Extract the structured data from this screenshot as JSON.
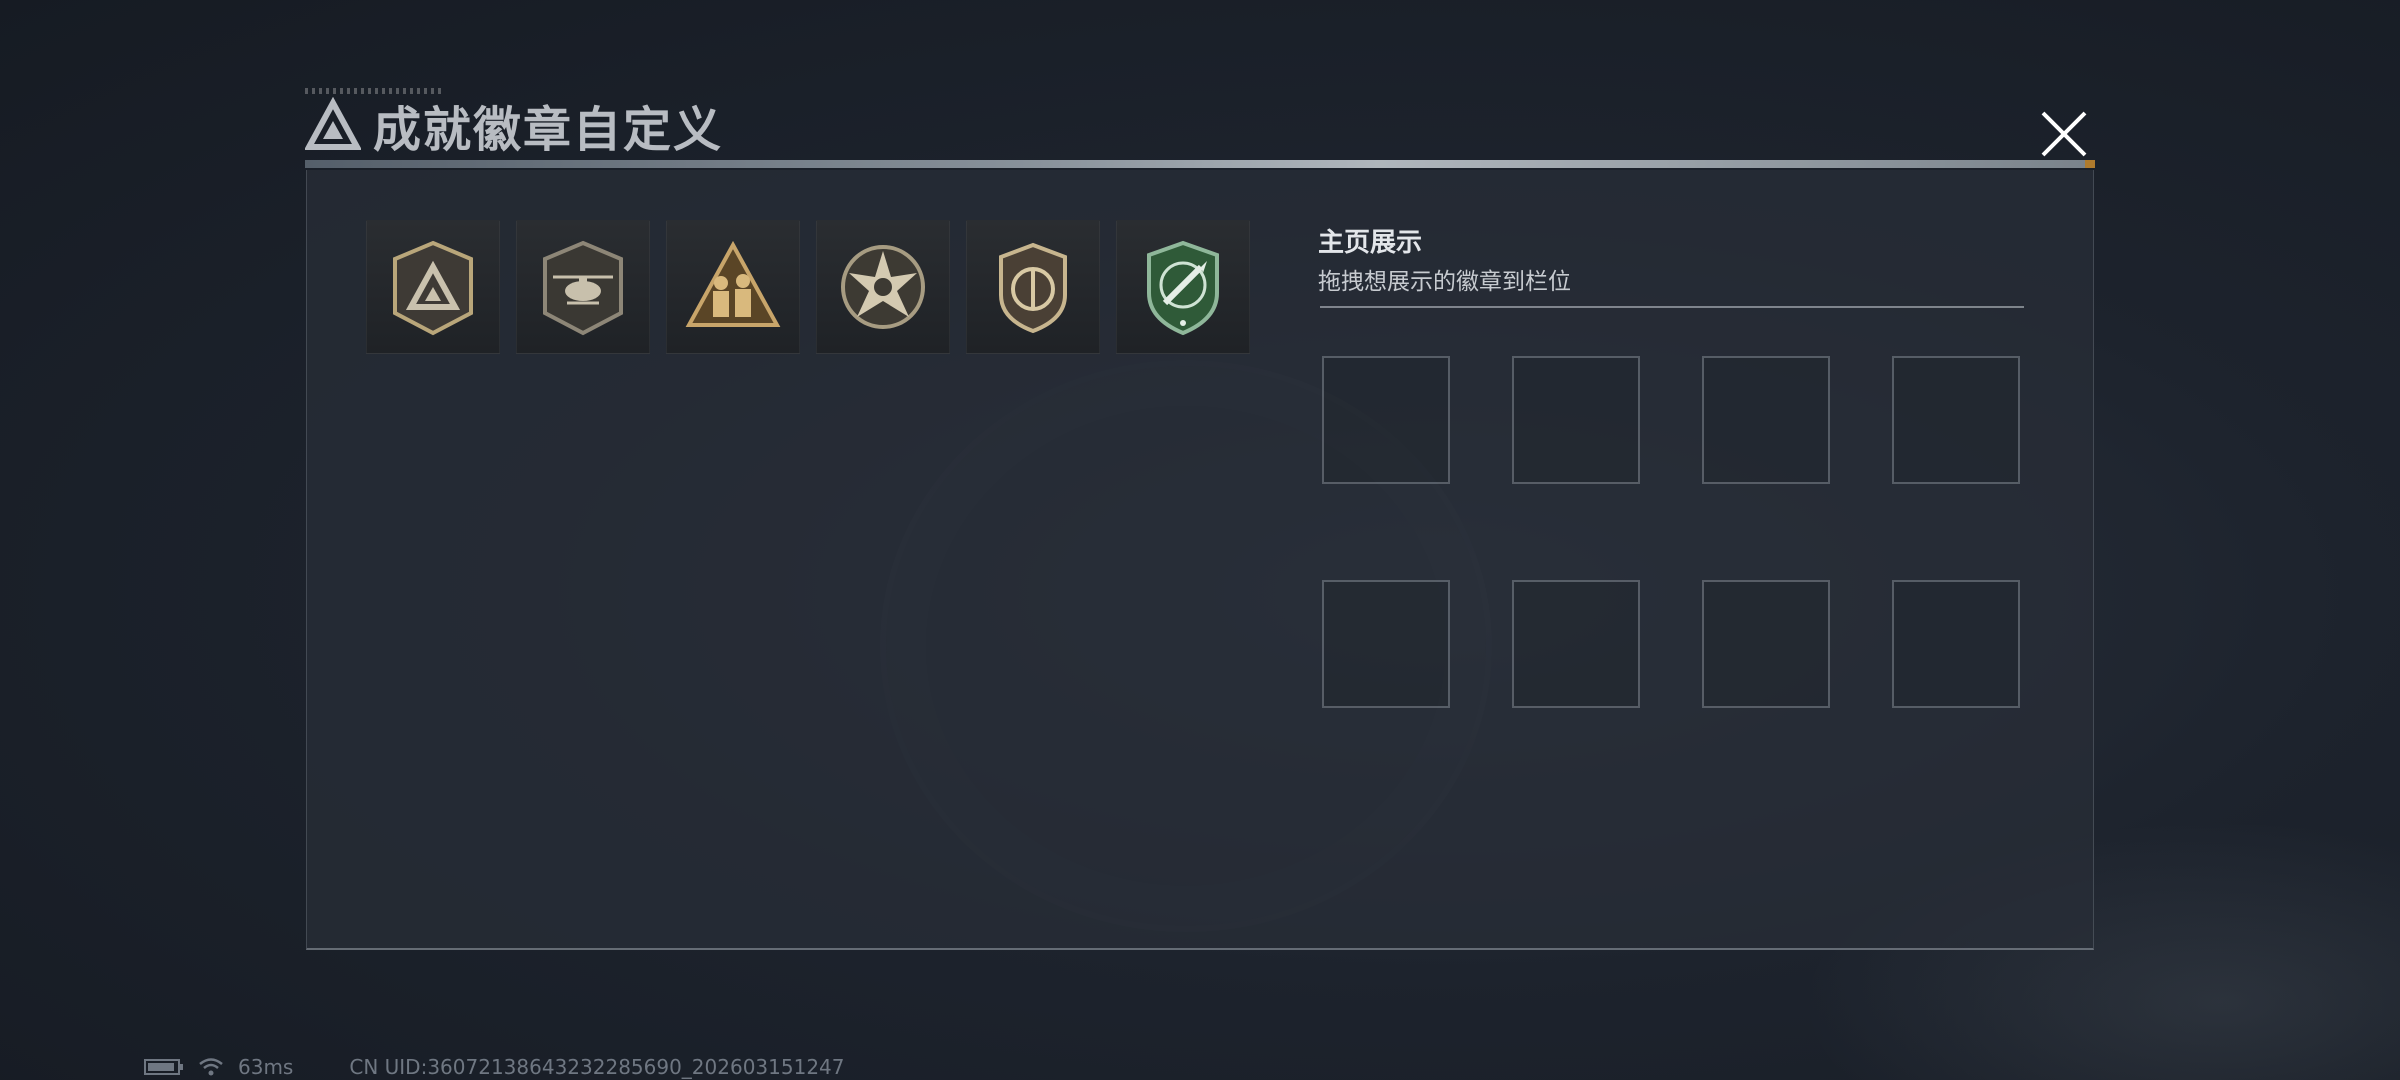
{
  "dialog": {
    "title": "成就徽章自定义",
    "title_icon": "triangle-logo-icon",
    "close_icon": "close-icon"
  },
  "badges": [
    {
      "icon": "shield-triangle-badge-icon"
    },
    {
      "icon": "helicopter-badge-icon"
    },
    {
      "icon": "soldiers-triangle-badge-icon"
    },
    {
      "icon": "star-skull-badge-icon"
    },
    {
      "icon": "shield-emblem-badge-icon"
    },
    {
      "icon": "green-knife-shield-badge-icon"
    }
  ],
  "showcase": {
    "title": "主页展示",
    "subtitle": "拖拽想展示的徽章到栏位",
    "slot_count": 8
  },
  "status_bar": {
    "ping": "63ms",
    "uid": "CN UID:36072138643232285690_202603151247"
  },
  "colors": {
    "accent_orange": "#c98b2e",
    "badge_gold": "#b9a67a",
    "badge_green": "#3f7a4c"
  }
}
